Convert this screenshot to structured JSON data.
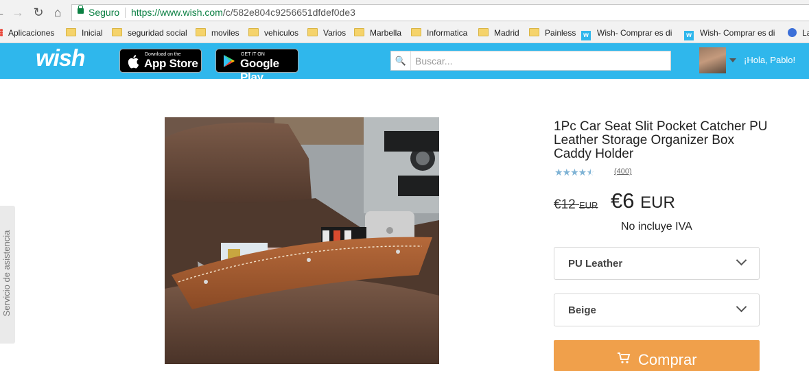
{
  "browser": {
    "secure_label": "Seguro",
    "url_host": "https://www.wish.com",
    "url_path": "/c/582e804c9256651dfdef0de3",
    "bookmarks": [
      {
        "label": "Aplicaciones",
        "icon": "apps-grid-icon"
      },
      {
        "label": "Inicial",
        "icon": "folder-icon"
      },
      {
        "label": "seguridad social",
        "icon": "folder-icon"
      },
      {
        "label": "moviles",
        "icon": "folder-icon"
      },
      {
        "label": "vehiculos",
        "icon": "folder-icon"
      },
      {
        "label": "Varios",
        "icon": "folder-icon"
      },
      {
        "label": "Marbella",
        "icon": "folder-icon"
      },
      {
        "label": "Informatica",
        "icon": "folder-icon"
      },
      {
        "label": "Madrid",
        "icon": "folder-icon"
      },
      {
        "label": "Painless",
        "icon": "folder-icon"
      },
      {
        "label": "Wish- Comprar es di",
        "icon": "wish-favicon"
      },
      {
        "label": "Wish- Comprar es di",
        "icon": "wish-favicon"
      },
      {
        "label": "La",
        "icon": "globe-icon"
      }
    ]
  },
  "header": {
    "logo": "wish",
    "appstore_small": "Download on the",
    "appstore_big": "App Store",
    "googleplay_small": "GET IT ON",
    "googleplay_big": "Google Play",
    "search_placeholder": "Buscar...",
    "greeting": "¡Hola, Pablo!",
    "brand_color": "#2fb7ec"
  },
  "help_tab": "Servicio de asistencia",
  "product": {
    "title": "1Pc Car Seat Slit Pocket Catcher PU Leather Storage Organizer Box Caddy Holder",
    "rating": 4.5,
    "reviews": "(400)",
    "old_price": "€12",
    "old_currency": "EUR",
    "price": "€6",
    "currency": "EUR",
    "tax_note": "No incluye IVA",
    "material": "PU Leather",
    "color": "Beige",
    "buy_label": "Comprar",
    "buy_color": "#f0a04b"
  }
}
